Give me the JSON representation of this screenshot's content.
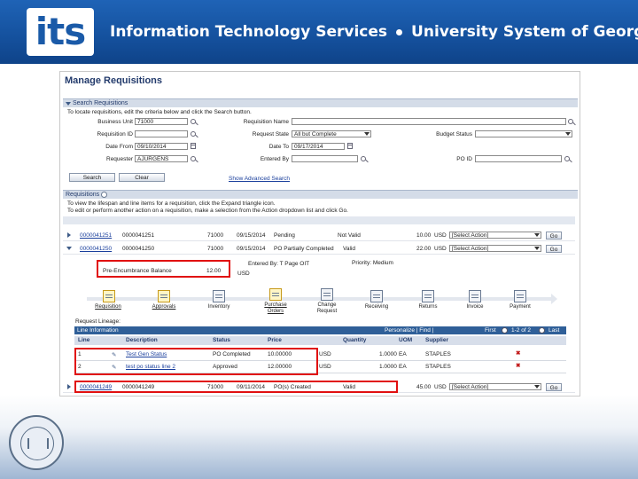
{
  "banner": {
    "logo_text": "its",
    "title_left": "Information Technology Services",
    "title_right": "University System of Georgia"
  },
  "page": {
    "title": "Manage Requisitions",
    "search_section": {
      "header": "Search Requisitions",
      "instructions": "To locate requisitions, edit the criteria below and click the Search button.",
      "fields": {
        "business_unit_label": "Business Unit",
        "business_unit_value": "71000",
        "requisition_name_label": "Requisition Name",
        "requisition_name_value": "",
        "requisition_id_label": "Requisition ID",
        "requisition_id_value": "",
        "request_state_label": "Request State",
        "request_state_value": "All but Complete",
        "budget_status_label": "Budget Status",
        "budget_status_value": "",
        "date_from_label": "Date From",
        "date_from_value": "09/10/2014",
        "date_to_label": "Date To",
        "date_to_value": "09/17/2014",
        "requester_label": "Requester",
        "requester_value": "AJURGENS",
        "entered_by_label": "Entered By",
        "entered_by_value": "",
        "po_id_label": "PO ID",
        "po_id_value": ""
      },
      "search_button": "Search",
      "clear_button": "Clear",
      "advanced_link": "Show Advanced Search"
    },
    "requisitions_section": {
      "header": "Requisitions",
      "instr1": "To view the lifespan and line items for a requisition, click the Expand triangle icon.",
      "instr2": "To edit or perform another action on a requisition, make a selection from the Action dropdown list and click Go.",
      "rows": [
        {
          "id": "0000041251",
          "name": "0000041251",
          "bu": "71000",
          "date": "09/15/2014",
          "status": "Pending",
          "budget": "Not Valid",
          "amount": "10.00",
          "currency": "USD",
          "action": "[Select Action]",
          "go": "Go"
        },
        {
          "id": "0000041250",
          "name": "0000041250",
          "bu": "71000",
          "date": "09/15/2014",
          "status": "PO Partially Completed",
          "budget": "Valid",
          "amount": "22.00",
          "currency": "USD",
          "action": "[Select Action]",
          "go": "Go"
        },
        {
          "id": "0000041249",
          "name": "0000041249",
          "bu": "71000",
          "date": "09/11/2014",
          "status": "PO(s) Created",
          "budget": "Valid",
          "amount": "45.00",
          "currency": "USD",
          "action": "[Select Action]",
          "go": "Go"
        }
      ],
      "expanded": {
        "entered_by": "Entered By: T Page OIT",
        "priority": "Priority: Medium",
        "pre_enc_label": "Pre-Encumbrance Balance",
        "pre_enc_value": "12.00",
        "pre_enc_currency": "USD",
        "stages": [
          "Requisition",
          "Approvals",
          "Inventory",
          "Purchase Orders",
          "Change Request",
          "Receiving",
          "Returns",
          "Invoice",
          "Payment"
        ],
        "lineage_label": "Request Lineage:",
        "line_info": {
          "header": "Line Information",
          "nav_text": "Personalize | Find |",
          "first_label": "First",
          "range": "1-2 of 2",
          "last_label": "Last",
          "columns": [
            "Line",
            "Description",
            "Status",
            "Price",
            "Quantity",
            "UOM",
            "Supplier"
          ],
          "lines": [
            {
              "line": "1",
              "description": "Test Gen Status",
              "status": "PO Completed",
              "price": "10.00000",
              "currency": "USD",
              "quantity": "1.0000",
              "uom": "EA",
              "supplier": "STAPLES"
            },
            {
              "line": "2",
              "description": "test po status line 2",
              "status": "Approved",
              "price": "12.00000",
              "currency": "USD",
              "quantity": "1.0000",
              "uom": "EA",
              "supplier": "STAPLES"
            }
          ]
        }
      }
    }
  },
  "colors": {
    "banner": "#15529f",
    "highlight": "#e11010",
    "link": "#1a3f9c"
  }
}
